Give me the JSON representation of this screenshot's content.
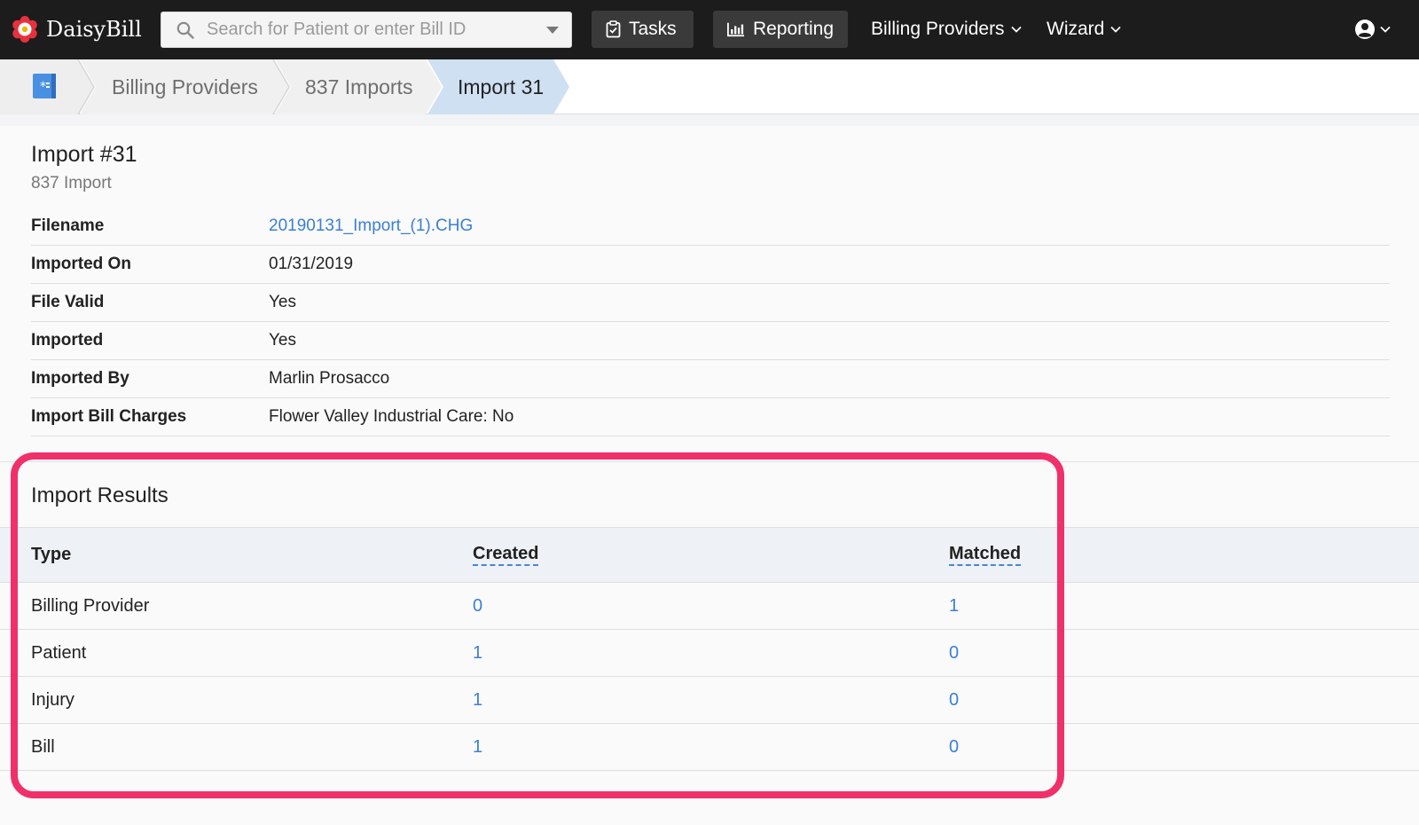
{
  "app": {
    "name": "DaisyBill"
  },
  "topnav": {
    "search_placeholder": "Search for Patient or enter Bill ID",
    "tasks_label": "Tasks",
    "reporting_label": "Reporting",
    "billing_providers_label": "Billing Providers",
    "wizard_label": "Wizard"
  },
  "breadcrumb": {
    "items": [
      {
        "label": "Billing Providers"
      },
      {
        "label": "837 Imports"
      },
      {
        "label": "Import 31"
      }
    ]
  },
  "page": {
    "title": "Import #31",
    "subtitle": "837 Import"
  },
  "details": [
    {
      "label": "Filename",
      "value": "20190131_Import_(1).CHG"
    },
    {
      "label": "Imported On",
      "value": "01/31/2019"
    },
    {
      "label": "File Valid",
      "value": "Yes"
    },
    {
      "label": "Imported",
      "value": "Yes"
    },
    {
      "label": "Imported By",
      "value": "Marlin Prosacco"
    },
    {
      "label": "Import Bill Charges",
      "value": "Flower Valley Industrial Care: No"
    }
  ],
  "results": {
    "title": "Import Results",
    "columns": {
      "type": "Type",
      "created": "Created",
      "matched": "Matched"
    },
    "rows": [
      {
        "type": "Billing Provider",
        "created": "0",
        "matched": "1"
      },
      {
        "type": "Patient",
        "created": "1",
        "matched": "0"
      },
      {
        "type": "Injury",
        "created": "1",
        "matched": "0"
      },
      {
        "type": "Bill",
        "created": "1",
        "matched": "0"
      }
    ]
  },
  "colors": {
    "nav_bg": "#1c1c1c",
    "link": "#3b7fd4",
    "highlight": "#f0306b",
    "active_crumb": "#cfe0f2"
  },
  "icons": {
    "brand": "daisy-flower-icon",
    "search": "magnifier-icon",
    "tasks": "clipboard-check-icon",
    "reporting": "bar-chart-icon",
    "user": "user-circle-icon",
    "home": "id-card-icon"
  }
}
